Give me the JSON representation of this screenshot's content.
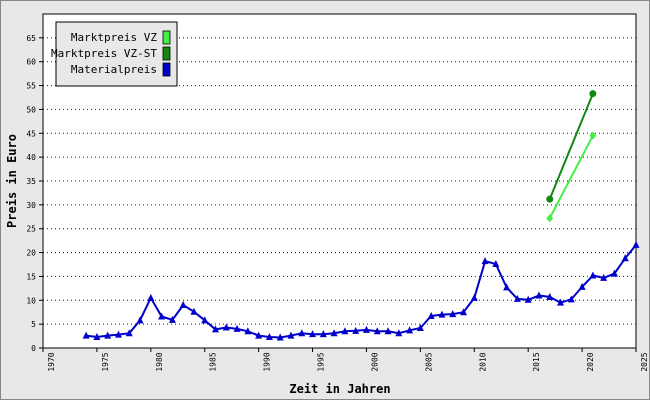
{
  "chart_data": {
    "type": "line",
    "title": "",
    "xlabel": "Zeit in Jahren",
    "ylabel": "Preis in Euro",
    "xlim": [
      1970,
      2025
    ],
    "ylim": [
      0,
      70
    ],
    "x_ticks": [
      1970,
      1975,
      1980,
      1985,
      1990,
      1995,
      2000,
      2005,
      2010,
      2015,
      2020,
      2025
    ],
    "y_ticks": [
      0,
      5,
      10,
      15,
      20,
      25,
      30,
      35,
      40,
      45,
      50,
      55,
      60,
      65
    ],
    "grid": "horizontal dotted",
    "legend_position": "top-left",
    "series": [
      {
        "name": "Marktpreis VZ",
        "color": "#44ee44",
        "marker": "diamond",
        "points": [
          [
            2017,
            27.2
          ],
          [
            2021,
            44.5
          ]
        ]
      },
      {
        "name": "Marktpreis VZ-ST",
        "color": "#118811",
        "marker": "circle",
        "points": [
          [
            2017,
            31.2
          ],
          [
            2021,
            53.3
          ]
        ]
      },
      {
        "name": "Materialpreis",
        "color": "#0000cc",
        "marker": "triangle",
        "points": [
          [
            1974,
            2.6
          ],
          [
            1975,
            2.3
          ],
          [
            1976,
            2.6
          ],
          [
            1977,
            2.8
          ],
          [
            1978,
            3.1
          ],
          [
            1979,
            5.8
          ],
          [
            1980,
            10.5
          ],
          [
            1981,
            6.6
          ],
          [
            1982,
            5.9
          ],
          [
            1983,
            9.0
          ],
          [
            1984,
            7.6
          ],
          [
            1985,
            5.8
          ],
          [
            1986,
            3.9
          ],
          [
            1987,
            4.3
          ],
          [
            1988,
            4.0
          ],
          [
            1989,
            3.5
          ],
          [
            1990,
            2.6
          ],
          [
            1991,
            2.3
          ],
          [
            1992,
            2.2
          ],
          [
            1993,
            2.6
          ],
          [
            1994,
            3.1
          ],
          [
            1995,
            2.9
          ],
          [
            1996,
            2.9
          ],
          [
            1997,
            3.1
          ],
          [
            1998,
            3.5
          ],
          [
            1999,
            3.6
          ],
          [
            2000,
            3.8
          ],
          [
            2001,
            3.5
          ],
          [
            2002,
            3.5
          ],
          [
            2003,
            3.1
          ],
          [
            2004,
            3.7
          ],
          [
            2005,
            4.2
          ],
          [
            2006,
            6.7
          ],
          [
            2007,
            7.0
          ],
          [
            2008,
            7.1
          ],
          [
            2009,
            7.5
          ],
          [
            2010,
            10.5
          ],
          [
            2011,
            18.2
          ],
          [
            2012,
            17.6
          ],
          [
            2013,
            12.7
          ],
          [
            2014,
            10.3
          ],
          [
            2015,
            10.1
          ],
          [
            2016,
            11.0
          ],
          [
            2017,
            10.7
          ],
          [
            2018,
            9.5
          ],
          [
            2019,
            10.2
          ],
          [
            2020,
            12.8
          ],
          [
            2021,
            15.2
          ],
          [
            2022,
            14.7
          ],
          [
            2023,
            15.6
          ],
          [
            2024,
            18.8
          ],
          [
            2025,
            21.6
          ]
        ]
      }
    ]
  }
}
